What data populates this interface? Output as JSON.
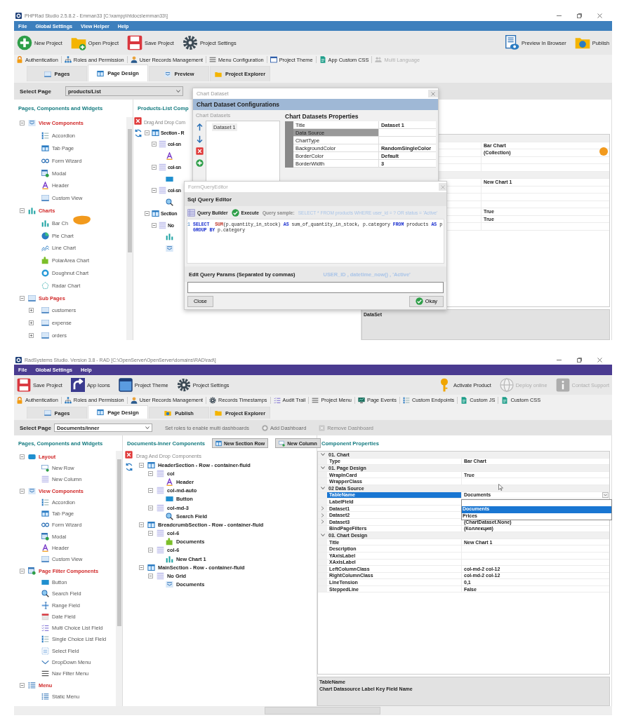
{
  "windows": [
    {
      "kind": "phprad",
      "title": "PHPRad Studio 2.5.8.2 - Emman33 [C:\\xampp\\htdocs\\emman33\\]",
      "menu": [
        "File",
        "Global Settings",
        "View Helper",
        "Help"
      ],
      "toolbar": [
        {
          "label": "New Project",
          "kind": "plus",
          "disabled": false
        },
        {
          "label": "Open Project",
          "kind": "folderplus",
          "disabled": false
        },
        {
          "label": "Save Project",
          "kind": "floppy",
          "disabled": false
        },
        {
          "label": "Project Settings",
          "kind": "gear",
          "disabled": false
        }
      ],
      "toolbar_right": [
        {
          "label": "Preview In Browser",
          "kind": "preview",
          "disabled": false
        },
        {
          "label": "Publish",
          "kind": "publish",
          "disabled": false
        }
      ],
      "quick_links": [
        {
          "label": "Authentication",
          "kind": "lock",
          "disabled": false
        },
        {
          "label": "Roles and Permission",
          "kind": "hierarchy",
          "disabled": false
        },
        {
          "label": "User Records Management",
          "kind": "user",
          "disabled": false
        },
        {
          "label": "Menu Configuration",
          "kind": "menu",
          "disabled": false
        },
        {
          "label": "Project Theme",
          "kind": "theme",
          "disabled": false
        },
        {
          "label": "App Custom CSS",
          "kind": "cssdoc",
          "disabled": false
        },
        {
          "label": "Multi Language",
          "kind": "people",
          "disabled": true
        }
      ],
      "tabs": [
        {
          "label": "Pages",
          "kind": "page",
          "selected": false
        },
        {
          "label": "Page Design",
          "kind": "design",
          "selected": true
        },
        {
          "label": "Preview",
          "kind": "view",
          "selected": false
        },
        {
          "label": "Project Explorer",
          "kind": "folder",
          "selected": false
        }
      ],
      "select_page": {
        "label": "Select Page",
        "value": "products/List"
      },
      "left_panel": {
        "title": "Pages, Components and Widgets",
        "tree": [
          {
            "label": "View Components",
            "kind": "view",
            "expanded": true,
            "children": [
              {
                "label": "Accordion",
                "kind": "accordion"
              },
              {
                "label": "Tab Page",
                "kind": "tabpage"
              },
              {
                "label": "Form Wizard",
                "kind": "wizard"
              },
              {
                "label": "Modal",
                "kind": "modal"
              },
              {
                "label": "Header",
                "kind": "letter"
              },
              {
                "label": "Custom View",
                "kind": "page"
              }
            ]
          },
          {
            "label": "Charts",
            "kind": "bars",
            "expanded": true,
            "children": [
              {
                "label": "Bar Ch",
                "kind": "bars"
              },
              {
                "label": "Pie Chart",
                "kind": "pie"
              },
              {
                "label": "Line Chart",
                "kind": "line"
              },
              {
                "label": "PolarArea Chart",
                "kind": "puzzle"
              },
              {
                "label": "Doughnut Chart",
                "kind": "donut"
              },
              {
                "label": "Radar Chart",
                "kind": "radar"
              }
            ]
          },
          {
            "label": "Sub Pages",
            "kind": "page",
            "expanded": true,
            "children": [
              {
                "label": "customers",
                "kind": "page",
                "expanded": false
              },
              {
                "label": "expense",
                "kind": "page",
                "expanded": false
              },
              {
                "label": "orders",
                "kind": "page",
                "expanded": false
              }
            ]
          }
        ]
      },
      "middle_panel": {
        "title": "Products-List Comp",
        "root": "Drag And Drop Com",
        "tree": [
          {
            "label": "Section - R",
            "kind": "section",
            "expanded": true,
            "children": [
              {
                "label": "col-sn",
                "kind": "col",
                "expanded": true,
                "children": [
                  {
                    "kind": "letter"
                  }
                ]
              },
              {
                "label": "col-sn",
                "kind": "col",
                "expanded": true,
                "children": [
                  {
                    "kind": "button"
                  }
                ]
              },
              {
                "label": "col-sn",
                "kind": "col",
                "expanded": true,
                "children": [
                  {
                    "kind": "search"
                  }
                ]
              }
            ]
          },
          {
            "label": "Section",
            "kind": "section",
            "expanded": true,
            "children": [
              {
                "label": "No",
                "kind": "col",
                "expanded": true,
                "children": [
                  {
                    "kind": "bars"
                  },
                  {
                    "kind": "view"
                  }
                ]
              }
            ]
          }
        ]
      },
      "right_panel": {
        "rows": [
          {
            "kind": "category"
          },
          {
            "kind": "property",
            "value": "Bar Chart"
          },
          {
            "kind": "property",
            "value": "(Collection)"
          },
          {
            "kind": "property"
          },
          {
            "kind": "property"
          },
          {
            "kind": "category"
          },
          {
            "kind": "property",
            "value": "New Chart 1"
          },
          {
            "kind": "property"
          },
          {
            "kind": "property"
          },
          {
            "kind": "property"
          },
          {
            "kind": "property",
            "value": "True"
          },
          {
            "kind": "property",
            "value": "True"
          },
          {
            "kind": "property"
          }
        ],
        "description": {
          "title": "DataSet"
        }
      },
      "dataset_dialog": {
        "title": "Chart Dataset",
        "header": "Chart Dataset Configurations",
        "list_label": "Chart Datasets",
        "datasets": [
          "Dataset 1"
        ],
        "properties_title": "Chart Datasets Properties",
        "properties": [
          {
            "name": "Title",
            "value": "Dataset 1",
            "selected": false
          },
          {
            "name": "Data Source",
            "selected": true
          },
          {
            "name": "ChartType",
            "selected": false
          },
          {
            "name": "BackgroundColor",
            "value": "RandomSingleColor",
            "selected": false
          },
          {
            "name": "BorderColor",
            "value": "Default",
            "selected": false
          },
          {
            "name": "BorderWidth",
            "value": "3",
            "selected": false
          }
        ]
      },
      "query_dialog": {
        "title": "FormQueryEditor",
        "header": "Sql Query Editor",
        "query_builder": "Query Builder",
        "execute": "Execute",
        "sample_label": "Query sample:",
        "sample": "SELECT * FROM products WHERE user_id = ? OR status = 'Active'",
        "code": [
          {
            "number": "1",
            "tokens": [
              {
                "text": "SELECT",
                "kind": "keyword"
              },
              {
                "text": "  SUM",
                "kind": "function"
              },
              {
                "text": "(p.quantity_in_stock) ",
                "kind": "plain"
              },
              {
                "text": "AS",
                "kind": "keyword"
              },
              {
                "text": " sum_of_quantity_in_stock, p.category ",
                "kind": "plain"
              },
              {
                "text": "FROM",
                "kind": "keyword"
              },
              {
                "text": " products ",
                "kind": "plain"
              },
              {
                "text": "AS",
                "kind": "keyword"
              },
              {
                "text": " p",
                "kind": "plain"
              }
            ]
          },
          {
            "tokens": [
              {
                "text": "GROUP BY",
                "kind": "keyword"
              },
              {
                "text": " p.category",
                "kind": "plain"
              }
            ]
          }
        ],
        "params_label": "Edit Query Params (Separated by commas)",
        "params_hint": "USER_ID , datetime_now() , 'Active'",
        "close": "Close",
        "okay": "Okay"
      }
    },
    {
      "kind": "radsystems",
      "title": "RadSystems Studio.  Version 3.8 - RAD [C:\\OpenServer\\OpenServer\\domains\\RAD\\rad\\]",
      "menu": [
        "File",
        "Global Settings",
        "Help"
      ],
      "toolbar": [
        {
          "label": "Save Project",
          "kind": "floppy",
          "disabled": false
        },
        {
          "label": "App Icons",
          "kind": "appicons",
          "disabled": false
        },
        {
          "label": "Project Theme",
          "kind": "themebig",
          "disabled": false
        },
        {
          "label": "Project Settings",
          "kind": "gear",
          "disabled": false
        }
      ],
      "toolbar_right": [
        {
          "label": "Activate Product",
          "kind": "key",
          "disabled": false
        },
        {
          "label": "Deploy online",
          "kind": "globe",
          "disabled": true
        },
        {
          "label": "Contact Support",
          "kind": "info",
          "disabled": true
        }
      ],
      "quick_links": [
        {
          "label": "Authentication",
          "kind": "lock",
          "disabled": false
        },
        {
          "label": "Roles and Permission",
          "kind": "hierarchy",
          "disabled": false
        },
        {
          "label": "User Records Management",
          "kind": "user",
          "disabled": false
        },
        {
          "label": "Records Timestamps",
          "kind": "gear",
          "disabled": false
        },
        {
          "label": "Audit Trail",
          "kind": "checklist",
          "disabled": false
        },
        {
          "label": "Project Menu",
          "kind": "menu",
          "disabled": false
        },
        {
          "label": "Page Events",
          "kind": "monitor",
          "disabled": false
        },
        {
          "label": "Custom Endpoints",
          "kind": "accordion",
          "disabled": false
        },
        {
          "label": "Custom JS",
          "kind": "cssdoc",
          "disabled": false
        },
        {
          "label": "Custom CSS",
          "kind": "cssdoc",
          "disabled": false
        }
      ],
      "tabs": [
        {
          "label": "Pages",
          "kind": "page",
          "selected": false
        },
        {
          "label": "Page Design",
          "kind": "design",
          "selected": true
        },
        {
          "label": "Publish",
          "kind": "publish",
          "selected": false
        },
        {
          "label": "Project Explorer",
          "kind": "folder",
          "selected": false
        }
      ],
      "select_page": {
        "label": "Select Page",
        "value": "Documents/inner"
      },
      "page_actions": [
        {
          "label": "Set roles to enable multi dashboards",
          "kind": "text",
          "disabled": false
        },
        {
          "label": "Add Dashboard",
          "kind": "plus",
          "disabled": false
        },
        {
          "label": "Remove Dashboard",
          "kind": "remove",
          "disabled": true
        }
      ],
      "left_panel": {
        "title": "Pages, Components and Widgets",
        "tree": [
          {
            "label": "Layout",
            "kind": "layout",
            "expanded": true,
            "children": [
              {
                "label": "New Row",
                "kind": "row"
              },
              {
                "label": "New Column",
                "kind": "col"
              }
            ]
          },
          {
            "label": "View Components",
            "kind": "view",
            "expanded": true,
            "children": [
              {
                "label": "Accordion",
                "kind": "accordion"
              },
              {
                "label": "Tab Page",
                "kind": "tabpage"
              },
              {
                "label": "Form Wizard",
                "kind": "wizard"
              },
              {
                "label": "Modal",
                "kind": "modal"
              },
              {
                "label": "Header",
                "kind": "letter"
              },
              {
                "label": "Custom View",
                "kind": "page"
              }
            ]
          },
          {
            "label": "Page Filter Components",
            "kind": "modal",
            "expanded": true,
            "children": [
              {
                "label": "Button",
                "kind": "button"
              },
              {
                "label": "Search Field",
                "kind": "search"
              },
              {
                "label": "Range Field",
                "kind": "range"
              },
              {
                "label": "Date Field",
                "kind": "calendar"
              },
              {
                "label": "Multi Choice List Field",
                "kind": "checklist"
              },
              {
                "label": "Single Choice List Field",
                "kind": "accordion"
              },
              {
                "label": "Select Field",
                "kind": "select"
              },
              {
                "label": "DropDown Menu",
                "kind": "chevron"
              },
              {
                "label": "Nav Filter Menu",
                "kind": "menu"
              }
            ]
          },
          {
            "label": "Menu",
            "kind": "list",
            "expanded": true,
            "children": [
              {
                "label": "Static Menu",
                "kind": "list"
              }
            ]
          }
        ]
      },
      "middle_panel": {
        "title": "Documents-Inner Components",
        "buttons": [
          {
            "label": "New Section Row",
            "kind": "section"
          },
          {
            "label": "New Column",
            "kind": "row"
          }
        ],
        "root": "Drag And Drop Components",
        "tree": [
          {
            "label": "HeaderSection - Row - container-fluid",
            "kind": "section",
            "expanded": true,
            "children": [
              {
                "label": "col",
                "kind": "col",
                "expanded": true,
                "children": [
                  {
                    "label": "Header",
                    "kind": "letter"
                  }
                ]
              },
              {
                "label": "col-md-auto",
                "kind": "col",
                "expanded": true,
                "children": [
                  {
                    "label": "Button",
                    "kind": "button"
                  }
                ]
              },
              {
                "label": "col-md-3",
                "kind": "col",
                "expanded": true,
                "children": [
                  {
                    "label": "Search Field",
                    "kind": "search"
                  }
                ]
              }
            ]
          },
          {
            "label": "BreadcrumbSection - Row - container-fluid",
            "kind": "section",
            "expanded": true,
            "children": [
              {
                "label": "col-6",
                "kind": "col",
                "expanded": true,
                "children": [
                  {
                    "label": "Documents",
                    "kind": "puzzle"
                  }
                ]
              },
              {
                "label": "col-6",
                "kind": "col",
                "expanded": true,
                "children": [
                  {
                    "label": "New Chart 1",
                    "kind": "bars"
                  }
                ]
              }
            ]
          },
          {
            "label": "MainSection - Row - container-fluid",
            "kind": "section",
            "expanded": true,
            "children": [
              {
                "label": "No Grid",
                "kind": "col",
                "expanded": true,
                "children": [
                  {
                    "label": "Documents",
                    "kind": "view"
                  }
                ]
              }
            ]
          }
        ]
      },
      "right_panel": {
        "title": "Component Properties",
        "rows": [
          {
            "kind": "category",
            "name": "01. Chart",
            "expanded": true
          },
          {
            "kind": "property",
            "name": "Type",
            "value": "Bar Chart",
            "selected": false
          },
          {
            "kind": "category",
            "name": "01. Page Design",
            "expanded": true
          },
          {
            "kind": "property",
            "name": "WrapInCard",
            "value": "True",
            "selected": false
          },
          {
            "kind": "property",
            "name": "WrapperClass",
            "selected": false
          },
          {
            "kind": "category",
            "name": "02 Data Source",
            "expanded": true
          },
          {
            "kind": "property",
            "name": "TableName",
            "value": "Documents",
            "selected": true,
            "dropdown": true
          },
          {
            "kind": "property",
            "name": "LabelField",
            "selected": false
          },
          {
            "kind": "property",
            "name": "Dataset1",
            "selected": false,
            "expanded": false
          },
          {
            "kind": "property",
            "name": "Dataset2",
            "selected": false,
            "expanded": false
          },
          {
            "kind": "property",
            "name": "Dataset3",
            "value": "(ChartDataset.None)",
            "selected": false,
            "expanded": false
          },
          {
            "kind": "property",
            "name": "BindPageFilters",
            "value": "(Коллекция)",
            "selected": false
          },
          {
            "kind": "category",
            "name": "03. Chart Design",
            "expanded": true
          },
          {
            "kind": "property",
            "name": "Title",
            "value": "New Chart 1",
            "selected": false
          },
          {
            "kind": "property",
            "name": "Description",
            "selected": false
          },
          {
            "kind": "property",
            "name": "YAxisLabel",
            "selected": false
          },
          {
            "kind": "property",
            "name": "XAxisLabel",
            "selected": false
          },
          {
            "kind": "property",
            "name": "LeftColumnClass",
            "value": "col-md-2 col-12",
            "selected": false
          },
          {
            "kind": "property",
            "name": "RightColumnClass",
            "value": "col-md-2 col-12",
            "selected": false
          },
          {
            "kind": "property",
            "name": "LineTension",
            "value": "0,1",
            "selected": false
          },
          {
            "kind": "property",
            "name": "SteppedLine",
            "value": "False",
            "selected": false
          }
        ],
        "dropdown_options": [
          {
            "label": "Documents",
            "selected": true
          },
          {
            "label": "Prices",
            "selected": false
          }
        ],
        "description": {
          "title": "TableName",
          "text": "Chart Datasource Label Key Field Name"
        }
      }
    }
  ]
}
